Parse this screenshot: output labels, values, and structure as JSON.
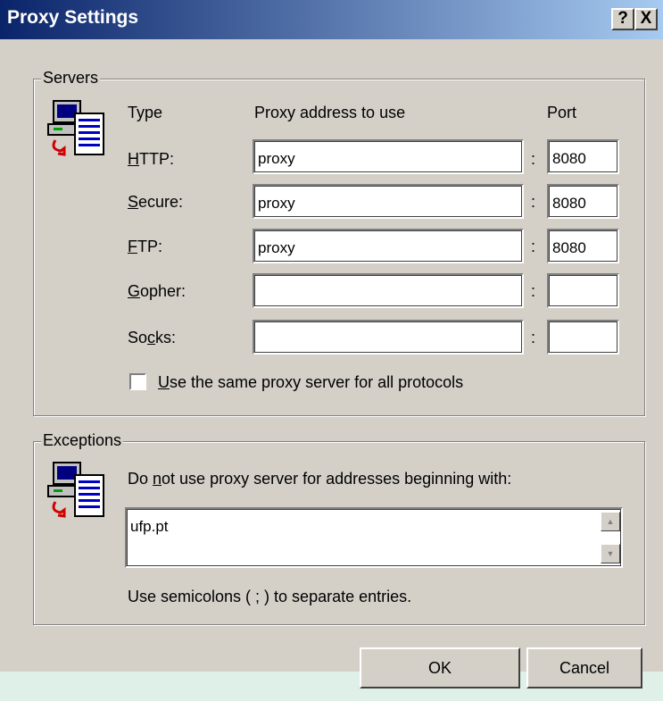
{
  "window": {
    "title": "Proxy Settings",
    "help_button": "?",
    "close_button": "X"
  },
  "servers": {
    "group_label": "Servers",
    "col_type": "Type",
    "col_address": "Proxy address to use",
    "col_port": "Port",
    "rows": [
      {
        "pre": "",
        "key": "H",
        "post": "TTP:",
        "address": "proxy",
        "port": "8080"
      },
      {
        "pre": "",
        "key": "S",
        "post": "ecure:",
        "address": "proxy",
        "port": "8080"
      },
      {
        "pre": "",
        "key": "F",
        "post": "TP:",
        "address": "proxy",
        "port": "8080"
      },
      {
        "pre": "",
        "key": "G",
        "post": "opher:",
        "address": "",
        "port": ""
      },
      {
        "pre": "So",
        "key": "c",
        "post": "ks:",
        "address": "",
        "port": ""
      }
    ],
    "colon": ":",
    "same_proxy": {
      "key": "U",
      "rest": "se the same proxy server for all protocols",
      "checked": false
    }
  },
  "exceptions": {
    "group_label": "Exceptions",
    "instruction_pre": "Do ",
    "instruction_key": "n",
    "instruction_post": "ot use proxy server for addresses beginning with:",
    "value": "ufp.pt",
    "hint": "Use semicolons ( ; ) to separate entries."
  },
  "buttons": {
    "ok": "OK",
    "cancel": "Cancel"
  },
  "colors": {
    "titlebar_start": "#0a246a",
    "titlebar_end": "#a6caf0",
    "face": "#d4d0c8"
  }
}
